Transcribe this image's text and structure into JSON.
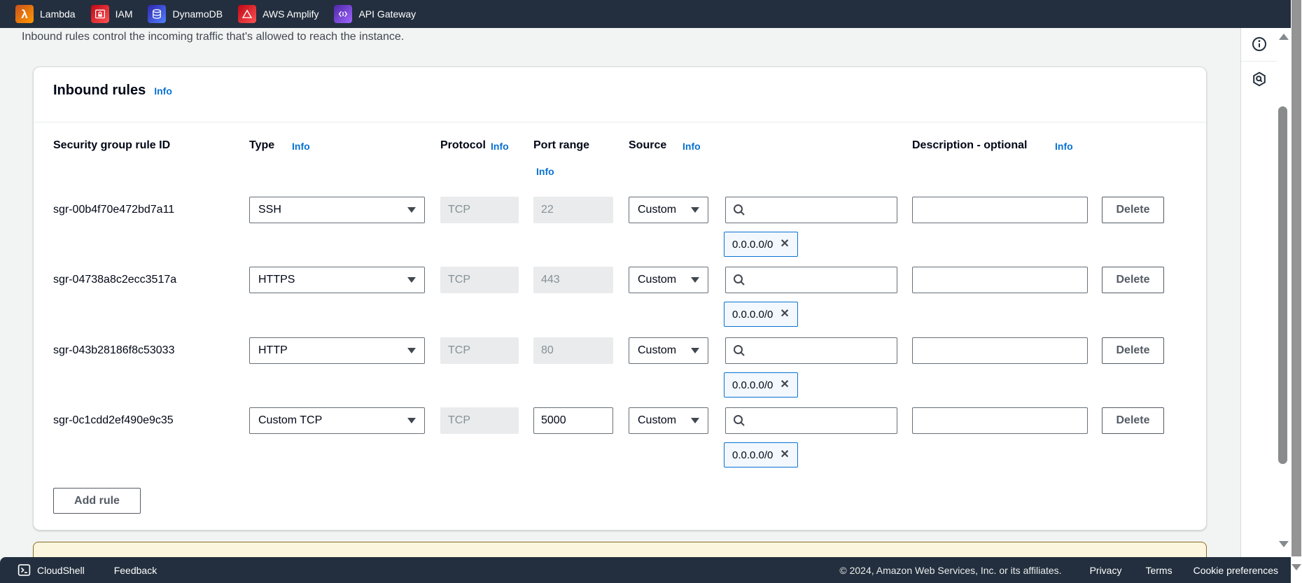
{
  "topbar": {
    "favorites": [
      {
        "label": "Lambda"
      },
      {
        "label": "IAM"
      },
      {
        "label": "DynamoDB"
      },
      {
        "label": "AWS Amplify"
      },
      {
        "label": "API Gateway"
      }
    ]
  },
  "page": {
    "subtitle": "Inbound rules control the incoming traffic that's allowed to reach the instance."
  },
  "panel": {
    "title": "Inbound rules",
    "info_label": "Info"
  },
  "table": {
    "headers": {
      "rule_id": "Security group rule ID",
      "type": "Type",
      "protocol": "Protocol",
      "port_range": "Port range",
      "source": "Source",
      "description": "Description - optional",
      "info_label": "Info"
    },
    "add_rule_label": "Add rule",
    "delete_label": "Delete",
    "rules": [
      {
        "id": "sgr-00b4f70e472bd7a11",
        "type": "SSH",
        "protocol": "TCP",
        "port": "22",
        "source": "Custom",
        "source_value": "0.0.0.0/0",
        "description": ""
      },
      {
        "id": "sgr-04738a8c2ecc3517a",
        "type": "HTTPS",
        "protocol": "TCP",
        "port": "443",
        "source": "Custom",
        "source_value": "0.0.0.0/0",
        "description": ""
      },
      {
        "id": "sgr-043b28186f8c53033",
        "type": "HTTP",
        "protocol": "TCP",
        "port": "80",
        "source": "Custom",
        "source_value": "0.0.0.0/0",
        "description": ""
      },
      {
        "id": "sgr-0c1cdd2ef490e9c35",
        "type": "Custom TCP",
        "protocol": "TCP",
        "port": "5000",
        "source": "Custom",
        "source_value": "0.0.0.0/0",
        "description": ""
      }
    ]
  },
  "footer": {
    "cloudshell_label": "CloudShell",
    "feedback_label": "Feedback",
    "copyright": "© 2024, Amazon Web Services, Inc. or its affiliates.",
    "privacy_label": "Privacy",
    "terms_label": "Terms",
    "cookie_label": "Cookie preferences"
  },
  "colors": {
    "topbar_bg": "#232f3e",
    "accent_blue": "#0972d3",
    "chip_bg": "#f2f8fd",
    "chip_border": "#0972d3",
    "button_border": "#545b64",
    "warning_bg": "#fcf6de",
    "warning_border": "#8a6d1d",
    "lambda_orange": "#ED7100",
    "iam_red": "#DD344C",
    "dynamodb_blue": "#527FFF",
    "amplify_red": "#DD344C",
    "apigateway_purple": "#8C4FFF"
  }
}
